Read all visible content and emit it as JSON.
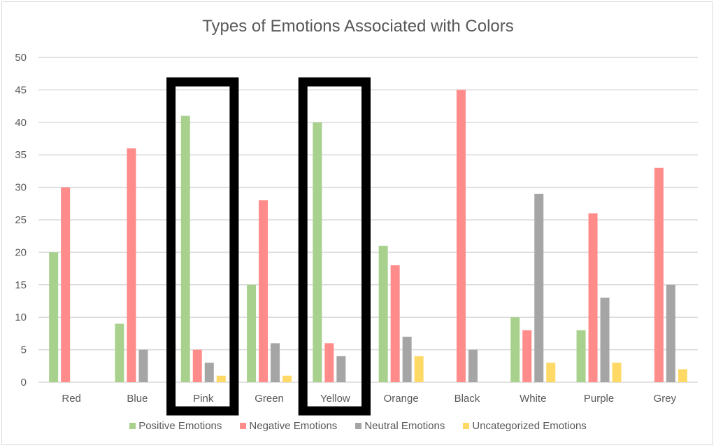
{
  "chart_data": {
    "type": "bar",
    "title": "Types of Emotions Associated with Colors",
    "xlabel": "",
    "ylabel": "",
    "ylim": [
      0,
      50
    ],
    "yticks": [
      0,
      5,
      10,
      15,
      20,
      25,
      30,
      35,
      40,
      45,
      50
    ],
    "grid": true,
    "legend_position": "bottom",
    "categories": [
      "Red",
      "Blue",
      "Pink",
      "Green",
      "Yellow",
      "Orange",
      "Black",
      "White",
      "Purple",
      "Grey"
    ],
    "series": [
      {
        "name": "Positive Emotions",
        "color": "#A9D18E",
        "values": [
          20,
          9,
          41,
          15,
          40,
          21,
          0,
          10,
          8,
          0
        ]
      },
      {
        "name": "Negative Emotions",
        "color": "#FF8B8B",
        "values": [
          30,
          36,
          5,
          28,
          6,
          18,
          45,
          8,
          26,
          33
        ]
      },
      {
        "name": "Neutral Emotions",
        "color": "#A5A5A5",
        "values": [
          0,
          5,
          3,
          6,
          4,
          7,
          5,
          29,
          13,
          15
        ]
      },
      {
        "name": "Uncategorized Emotions",
        "color": "#FFD966",
        "values": [
          0,
          0,
          1,
          1,
          0,
          4,
          0,
          3,
          3,
          2
        ]
      }
    ],
    "highlighted_categories": [
      "Pink",
      "Yellow"
    ],
    "highlight_color": "#000000"
  }
}
